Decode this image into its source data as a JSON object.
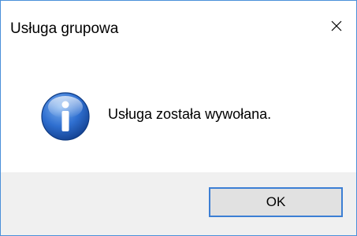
{
  "window": {
    "title": "Usługa grupowa",
    "close_icon": "close-icon",
    "accent_color": "#3c7fd4"
  },
  "message": {
    "icon": "info-icon",
    "text": "Usługa została wywołana."
  },
  "buttons": {
    "ok_label": "OK"
  }
}
